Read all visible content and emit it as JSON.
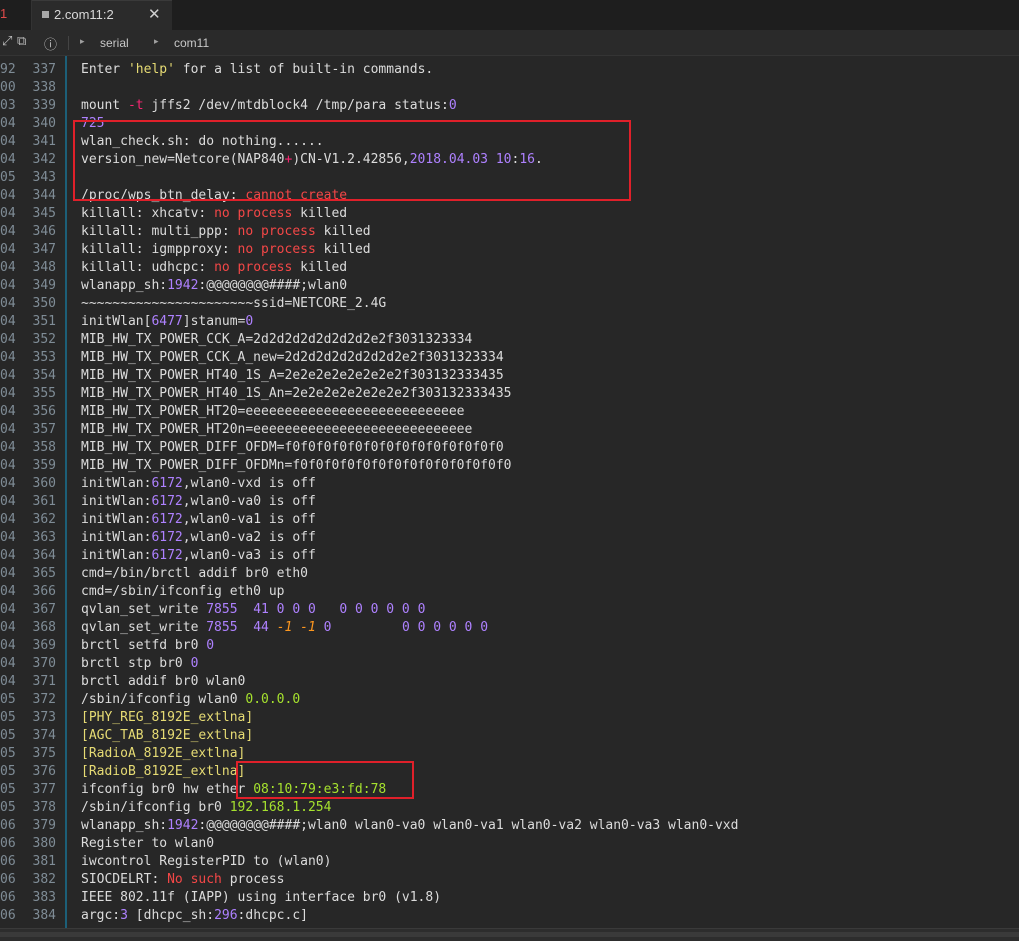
{
  "tabs": {
    "stub_label": "1",
    "active_label": "2.com11:2",
    "close_glyph": "✕"
  },
  "toolbar": {
    "crumbs": [
      "serial",
      "com11"
    ]
  },
  "colors": {
    "highlight": "#e0202a",
    "gutter_divider": "#1c5f78"
  },
  "lines": [
    {
      "prev": "92]",
      "num": "337",
      "html": "Enter <span class=\"c-str\">'help'</span> for a list of built-in commands."
    },
    {
      "prev": "00]",
      "num": "338",
      "html": ""
    },
    {
      "prev": "03]",
      "num": "339",
      "html": "mount <span class=\"c-kw\">-t</span> jffs2 /dev/mtdblock4 /tmp/para status:<span class=\"c-num\">0</span>"
    },
    {
      "prev": "04]",
      "num": "340",
      "html": "<span class=\"c-num\">725</span>"
    },
    {
      "prev": "04]",
      "num": "341",
      "html": "wlan_check.sh: do nothing......"
    },
    {
      "prev": "04]",
      "num": "342",
      "html": "version_new=Netcore(NAP840<span class=\"c-kw\">+</span>)CN-V1.2.42856,<span class=\"c-num\">2018.04.03 10</span>:<span class=\"c-num\">16</span>."
    },
    {
      "prev": "05]",
      "num": "343",
      "html": ""
    },
    {
      "prev": "04]",
      "num": "344",
      "html": "/proc/wps_btn_delay: <span class=\"c-err\">cannot create</span>"
    },
    {
      "prev": "04]",
      "num": "345",
      "html": "killall: xhcatv: <span class=\"c-err\">no process</span> killed"
    },
    {
      "prev": "04]",
      "num": "346",
      "html": "killall: multi_ppp: <span class=\"c-err\">no process</span> killed"
    },
    {
      "prev": "04]",
      "num": "347",
      "html": "killall: igmpproxy: <span class=\"c-err\">no process</span> killed"
    },
    {
      "prev": "04]",
      "num": "348",
      "html": "killall: udhcpc: <span class=\"c-err\">no process</span> killed"
    },
    {
      "prev": "04]",
      "num": "349",
      "html": "wlanapp_sh:<span class=\"c-num\">1942</span>:@@@@@@@@####;wlan0"
    },
    {
      "prev": "04]",
      "num": "350",
      "html": "~~~~~~~~~~~~~~~~~~~~~~ssid=NETCORE_2.4G"
    },
    {
      "prev": "04]",
      "num": "351",
      "html": "initWlan[<span class=\"c-num\">6477</span>]stanum=<span class=\"c-num\">0</span>"
    },
    {
      "prev": "04]",
      "num": "352",
      "html": "MIB_HW_TX_POWER_CCK_A=2d2d2d2d2d2d2d2e2f3031323334"
    },
    {
      "prev": "04]",
      "num": "353",
      "html": "MIB_HW_TX_POWER_CCK_A_new=2d2d2d2d2d2d2d2e2f3031323334"
    },
    {
      "prev": "04]",
      "num": "354",
      "html": "MIB_HW_TX_POWER_HT40_1S_A=2e2e2e2e2e2e2e2f303132333435"
    },
    {
      "prev": "04]",
      "num": "355",
      "html": "MIB_HW_TX_POWER_HT40_1S_An=2e2e2e2e2e2e2e2f303132333435"
    },
    {
      "prev": "04]",
      "num": "356",
      "html": "MIB_HW_TX_POWER_HT20=eeeeeeeeeeeeeeeeeeeeeeeeeeee"
    },
    {
      "prev": "04]",
      "num": "357",
      "html": "MIB_HW_TX_POWER_HT20n=eeeeeeeeeeeeeeeeeeeeeeeeeeee"
    },
    {
      "prev": "04]",
      "num": "358",
      "html": "MIB_HW_TX_POWER_DIFF_OFDM=f0f0f0f0f0f0f0f0f0f0f0f0f0f0"
    },
    {
      "prev": "04]",
      "num": "359",
      "html": "MIB_HW_TX_POWER_DIFF_OFDMn=f0f0f0f0f0f0f0f0f0f0f0f0f0f0"
    },
    {
      "prev": "04]",
      "num": "360",
      "html": "initWlan:<span class=\"c-num\">6172</span>,wlan0-vxd is off"
    },
    {
      "prev": "04]",
      "num": "361",
      "html": "initWlan:<span class=\"c-num\">6172</span>,wlan0-va0 is off"
    },
    {
      "prev": "04]",
      "num": "362",
      "html": "initWlan:<span class=\"c-num\">6172</span>,wlan0-va1 is off"
    },
    {
      "prev": "04]",
      "num": "363",
      "html": "initWlan:<span class=\"c-num\">6172</span>,wlan0-va2 is off"
    },
    {
      "prev": "04]",
      "num": "364",
      "html": "initWlan:<span class=\"c-num\">6172</span>,wlan0-va3 is off"
    },
    {
      "prev": "04]",
      "num": "365",
      "html": "cmd=/bin/brctl addif br0 eth0"
    },
    {
      "prev": "04]",
      "num": "366",
      "html": "cmd=/sbin/ifconfig eth0 up"
    },
    {
      "prev": "04]",
      "num": "367",
      "html": "qvlan_set_write <span class=\"c-num\">7855</span>  <span class=\"c-num\">41 0 0 0</span>   <span class=\"c-num\">0 0 0 0 0 0</span>"
    },
    {
      "prev": "04]",
      "num": "368",
      "html": "qvlan_set_write <span class=\"c-num\">7855</span>  <span class=\"c-num\">44</span> <span class=\"c-ital\">-1 -1</span> <span class=\"c-num\">0</span>         <span class=\"c-num\">0 0 0 0 0 0</span>"
    },
    {
      "prev": "04]",
      "num": "369",
      "html": "brctl setfd br0 <span class=\"c-num\">0</span>"
    },
    {
      "prev": "04]",
      "num": "370",
      "html": "brctl stp br0 <span class=\"c-num\">0</span>"
    },
    {
      "prev": "04]",
      "num": "371",
      "html": "brctl addif br0 wlan0"
    },
    {
      "prev": "05]",
      "num": "372",
      "html": "/sbin/ifconfig wlan0 <span class=\"c-ip\">0.0.0.0</span>"
    },
    {
      "prev": "05]",
      "num": "373",
      "html": "<span class=\"c-str\">[PHY_REG_8192E_extlna]</span>"
    },
    {
      "prev": "05]",
      "num": "374",
      "html": "<span class=\"c-str\">[AGC_TAB_8192E_extlna]</span>"
    },
    {
      "prev": "05]",
      "num": "375",
      "html": "<span class=\"c-str\">[RadioA_8192E_extlna]</span>"
    },
    {
      "prev": "05]",
      "num": "376",
      "html": "<span class=\"c-str\">[RadioB_8192E_extlna]</span>"
    },
    {
      "prev": "05]",
      "num": "377",
      "html": "ifconfig br0 hw ether <span class=\"c-ip\">08:10:79:e3:fd:78</span>"
    },
    {
      "prev": "05]",
      "num": "378",
      "html": "/sbin/ifconfig br0 <span class=\"c-ip\">192.168.1.254</span>"
    },
    {
      "prev": "06]",
      "num": "379",
      "html": "wlanapp_sh:<span class=\"c-num\">1942</span>:@@@@@@@@####;wlan0 wlan0-va0 wlan0-va1 wlan0-va2 wlan0-va3 wlan0-vxd"
    },
    {
      "prev": "06]",
      "num": "380",
      "html": "Register to wlan0"
    },
    {
      "prev": "06]",
      "num": "381",
      "html": "iwcontrol RegisterPID to (wlan0)"
    },
    {
      "prev": "06]",
      "num": "382",
      "html": "SIOCDELRT: <span class=\"c-err\">No such</span> process"
    },
    {
      "prev": "06]",
      "num": "383",
      "html": "IEEE 802.11f (IAPP) using interface br0 (v1.8)"
    },
    {
      "prev": "06]",
      "num": "384",
      "html": "argc:<span class=\"c-num\">3</span> [dhcpc_sh:<span class=\"c-num\">296</span>:dhcpc.c]"
    }
  ]
}
